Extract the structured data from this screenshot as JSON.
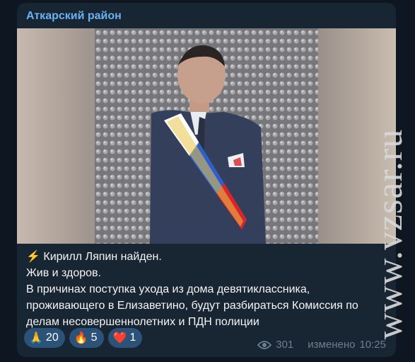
{
  "channel": {
    "name": "Аткарский район"
  },
  "post": {
    "lines": [
      "⚡ Кирилл Ляпин найден.",
      "Жив и здоров.",
      "В причинах поступка ухода из дома девятиклассника,",
      "проживающего в Елизаветино, будут разбираться Комиссия по",
      "делам несовершеннолетних и ПДН полиции"
    ],
    "reactions": [
      {
        "emoji": "🙏",
        "count": "20"
      },
      {
        "emoji": "🔥",
        "count": "5"
      },
      {
        "emoji": "❤️",
        "count": "1"
      }
    ],
    "views": "301",
    "edited": "изменено",
    "time": "10:25"
  },
  "watermark": "www.vzsar.ru",
  "colors": {
    "background": "#0e1621",
    "bubble": "#182533",
    "channel_name": "#6ab2f2",
    "reaction_bg": "#2b5278",
    "meta": "#6d7f8f"
  }
}
